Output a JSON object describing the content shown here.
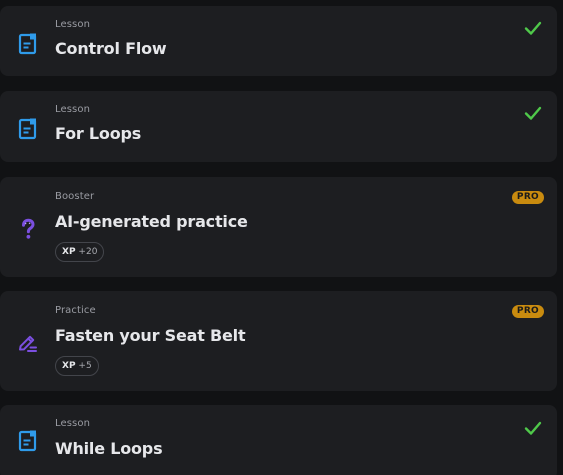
{
  "cards": [
    {
      "type": "Lesson",
      "title": "Control Flow",
      "icon": "lesson-document-icon",
      "status": "completed"
    },
    {
      "type": "Lesson",
      "title": "For Loops",
      "icon": "lesson-document-icon",
      "status": "completed"
    },
    {
      "type": "Booster",
      "title": "AI-generated practice",
      "icon": "question-mark-icon",
      "badge": "PRO",
      "xp_label": "XP",
      "xp_value": "+20"
    },
    {
      "type": "Practice",
      "title": "Fasten your Seat Belt",
      "icon": "pencil-icon",
      "badge": "PRO",
      "xp_label": "XP",
      "xp_value": "+5"
    },
    {
      "type": "Lesson",
      "title": "While Loops",
      "icon": "lesson-document-icon",
      "status": "completed"
    }
  ],
  "colors": {
    "background": "#111214",
    "card": "#1d1e21",
    "lesson_icon": "#2f9bea",
    "check": "#4fc94a",
    "pro_badge": "#c98b0f",
    "booster_icon": "#7b4fe0"
  }
}
